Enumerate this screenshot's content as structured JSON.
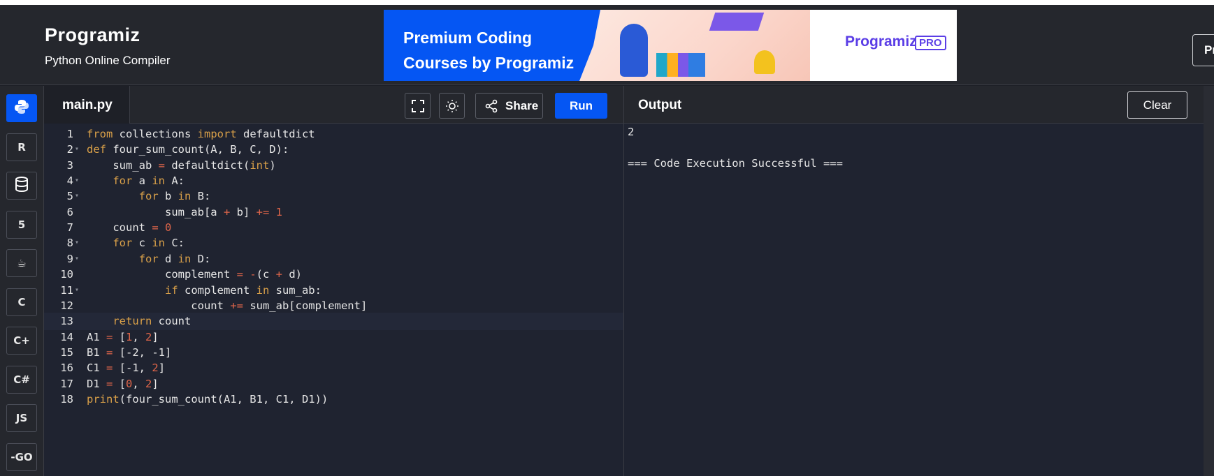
{
  "header": {
    "logo": "Programiz",
    "subtitle": "Python Online Compiler",
    "banner": {
      "headline_line1": "Premium Coding",
      "headline_line2": "Courses by Programiz",
      "logo": "Programiz",
      "badge": "PRO"
    },
    "right_button_partial": "Pr"
  },
  "sidebar": {
    "languages": [
      {
        "name": "python-icon",
        "label": "",
        "active": true
      },
      {
        "name": "r-icon",
        "label": "R",
        "active": false
      },
      {
        "name": "database-icon",
        "label": "",
        "active": false
      },
      {
        "name": "html5-icon",
        "label": "5",
        "active": false
      },
      {
        "name": "java-icon",
        "label": "☕",
        "active": false
      },
      {
        "name": "c-icon",
        "label": "C",
        "active": false
      },
      {
        "name": "cplusplus-icon",
        "label": "C+",
        "active": false
      },
      {
        "name": "csharp-icon",
        "label": "C#",
        "active": false
      },
      {
        "name": "javascript-icon",
        "label": "JS",
        "active": false
      },
      {
        "name": "go-icon",
        "label": "-GO",
        "active": false
      }
    ]
  },
  "editor": {
    "filename": "main.py",
    "share_label": "Share",
    "run_label": "Run",
    "lines": [
      "from collections import defaultdict",
      "def four_sum_count(A, B, C, D):",
      "    sum_ab = defaultdict(int)",
      "    for a in A:",
      "        for b in B:",
      "            sum_ab[a + b] += 1",
      "    count = 0",
      "    for c in C:",
      "        for d in D:",
      "            complement = -(c + d)",
      "            if complement in sum_ab:",
      "                count += sum_ab[complement]",
      "    return count",
      "A1 = [1, 2]",
      "B1 = [-2, -1]",
      "C1 = [-1, 2]",
      "D1 = [0, 2]",
      "print(four_sum_count(A1, B1, C1, D1))"
    ],
    "foldable_lines": [
      2,
      4,
      5,
      8,
      9,
      11
    ],
    "current_line": 13
  },
  "output": {
    "title": "Output",
    "clear_label": "Clear",
    "lines": [
      "2",
      "",
      "=== Code Execution Successful ==="
    ]
  },
  "colors": {
    "accent": "#0556f3",
    "keyword": "#d9a049",
    "number": "#e0664a",
    "background": "#1f2330"
  }
}
